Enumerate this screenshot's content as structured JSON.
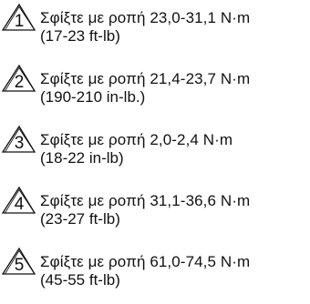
{
  "torque_notes": [
    {
      "number": "1",
      "line1": "Σφίξτε με ροπή 23,0-31,1 N·m",
      "line2": "(17-23 ft-lb)"
    },
    {
      "number": "2",
      "line1": "Σφίξτε με ροπή 21,4-23,7 N·m",
      "line2": "(190-210 in-lb.)"
    },
    {
      "number": "3",
      "line1": "Σφίξτε με ροπή 2,0-2,4 N·m",
      "line2": "(18-22 in-lb)"
    },
    {
      "number": "4",
      "line1": "Σφίξτε με ροπή 31,1-36,6 N·m",
      "line2": "(23-27 ft-lb)"
    },
    {
      "number": "5",
      "line1": "Σφίξτε με ροπή 61,0-74,5 N·m",
      "line2": "(45-55 ft-lb)"
    }
  ]
}
